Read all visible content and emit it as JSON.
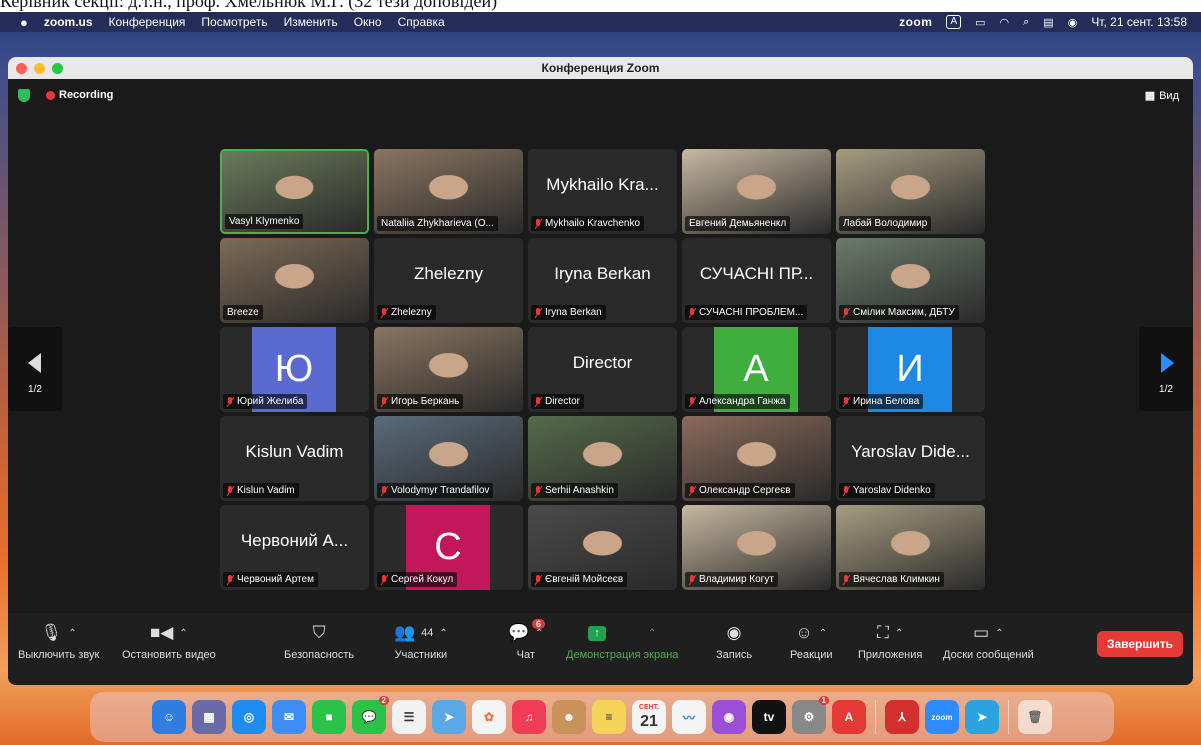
{
  "caption": "Керівник секції: д.т.н., проф. Хмельнюк М.Г. (32 тези доповідей)",
  "menubar": {
    "app": "zoom.us",
    "items": [
      "Конференция",
      "Посмотреть",
      "Изменить",
      "Окно",
      "Справка"
    ],
    "zoom": "zoom",
    "input": "A",
    "clock": "Чт, 21 сент.  13:58"
  },
  "window": {
    "title": "Конференция Zoom"
  },
  "meeting": {
    "recording": "Recording",
    "view": "Вид",
    "page_left": "1/2",
    "page_right": "1/2"
  },
  "tiles": [
    {
      "name": "Vasyl Klymenko",
      "muted": false,
      "big": "",
      "kind": "video",
      "active": true
    },
    {
      "name": "Nataliia Zhykharieva (O...",
      "muted": false,
      "big": "",
      "kind": "video"
    },
    {
      "name": "Mykhailo Kravchenko",
      "muted": true,
      "big": "Mykhailo Kra...",
      "kind": "text"
    },
    {
      "name": "Евгений Демьяненкл",
      "muted": false,
      "big": "",
      "kind": "video"
    },
    {
      "name": "Лабай Володимир",
      "muted": false,
      "big": "",
      "kind": "video"
    },
    {
      "name": "Breeze",
      "muted": false,
      "big": "",
      "kind": "video"
    },
    {
      "name": "Zhelezny",
      "muted": true,
      "big": "Zhelezny",
      "kind": "text"
    },
    {
      "name": "Iryna Berkan",
      "muted": true,
      "big": "Iryna Berkan",
      "kind": "text"
    },
    {
      "name": "СУЧАСНІ ПРОБЛЕМ...",
      "muted": true,
      "big": "СУЧАСНІ ПР...",
      "kind": "text"
    },
    {
      "name": "Смілик Максим, ДБТУ",
      "muted": true,
      "big": "",
      "kind": "video"
    },
    {
      "name": "Юрий Желиба",
      "muted": true,
      "big": "Ю",
      "kind": "avatar",
      "color": "#5b6ad0"
    },
    {
      "name": "Игорь Беркань",
      "muted": true,
      "big": "",
      "kind": "video"
    },
    {
      "name": "Director",
      "muted": true,
      "big": "Director",
      "kind": "text"
    },
    {
      "name": "Александра Ганжа",
      "muted": true,
      "big": "A",
      "kind": "avatar",
      "color": "#3fae3f"
    },
    {
      "name": "Ирина Белова",
      "muted": true,
      "big": "И",
      "kind": "avatar",
      "color": "#1e88e5"
    },
    {
      "name": "Kislun Vadim",
      "muted": true,
      "big": "Kislun Vadim",
      "kind": "text"
    },
    {
      "name": "Volodymyr Trandafilov",
      "muted": true,
      "big": "",
      "kind": "video"
    },
    {
      "name": "Serhii Anashkin",
      "muted": true,
      "big": "",
      "kind": "video"
    },
    {
      "name": "Олександр Сергеєв",
      "muted": true,
      "big": "",
      "kind": "video"
    },
    {
      "name": "Yaroslav Didenko",
      "muted": true,
      "big": "Yaroslav Dide...",
      "kind": "text"
    },
    {
      "name": "Червоний Артем",
      "muted": true,
      "big": "Червоний А...",
      "kind": "text"
    },
    {
      "name": "Сергей Кокул",
      "muted": true,
      "big": "C",
      "kind": "avatar",
      "color": "#c2185b"
    },
    {
      "name": "Євгеній Мойсеєв",
      "muted": true,
      "big": "",
      "kind": "video"
    },
    {
      "name": "Владимир Когут",
      "muted": true,
      "big": "",
      "kind": "video"
    },
    {
      "name": "Вячеслав Климкин",
      "muted": true,
      "big": "",
      "kind": "video"
    }
  ],
  "toolbar": {
    "mute": "Выключить звук",
    "video": "Остановить видео",
    "security": "Безопасность",
    "participants": "Участники",
    "participants_count": "44",
    "chat": "Чат",
    "chat_badge": "6",
    "share": "Демонстрация экрана",
    "record": "Запись",
    "reactions": "Реакции",
    "apps": "Приложения",
    "whiteboards": "Доски сообщений",
    "end": "Завершить"
  },
  "dock": {
    "calendar_month": "СЕНТ.",
    "calendar_day": "21",
    "messages_badge": "2",
    "settings_badge": "1"
  }
}
